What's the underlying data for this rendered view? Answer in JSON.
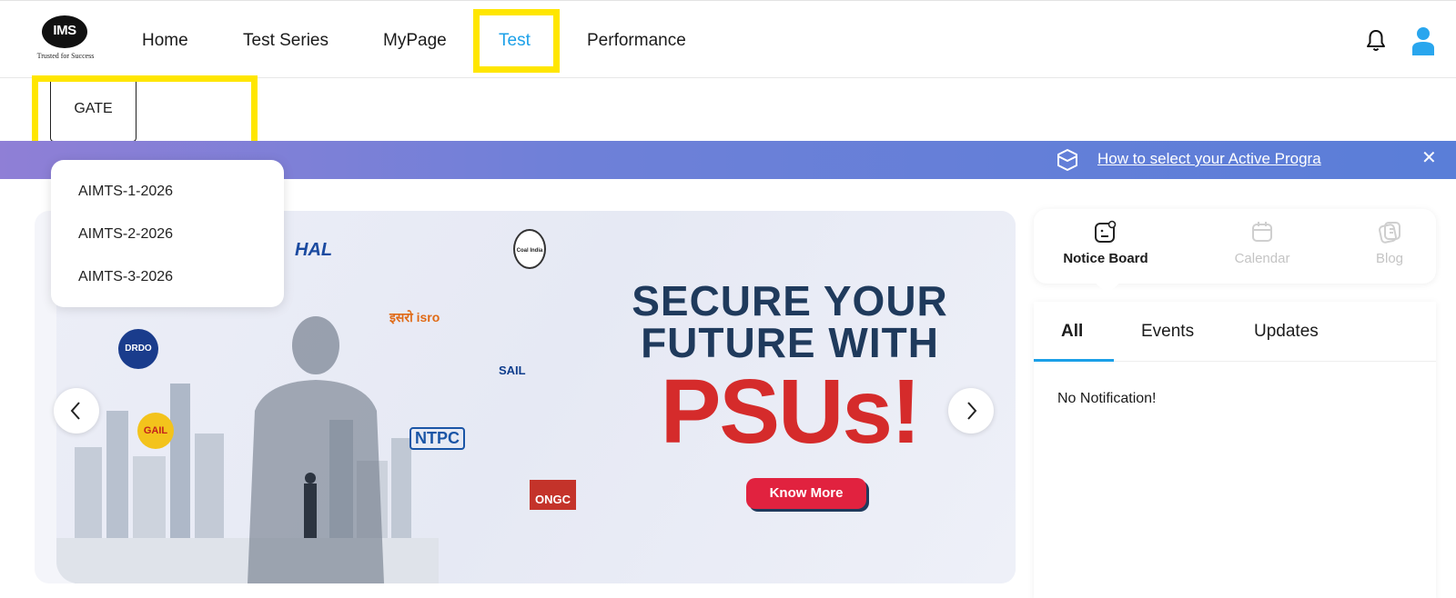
{
  "logo": {
    "text": "IMS",
    "tagline": "Trusted for Success"
  },
  "nav": {
    "items": [
      {
        "label": "Home"
      },
      {
        "label": "Test Series"
      },
      {
        "label": "MyPage"
      },
      {
        "label": "Test"
      },
      {
        "label": "Performance"
      }
    ],
    "active": "Test",
    "active_color": "#1ba0e8",
    "icons": [
      "bell-icon",
      "user-icon"
    ]
  },
  "subnav": {
    "tab_label": "GATE"
  },
  "highlight_color": "#ffe600",
  "announcement": {
    "link": "How to select your Active Progra",
    "close": "✕"
  },
  "dropdown": {
    "options": [
      "AIMTS-1-2026",
      "AIMTS-2-2026",
      "AIMTS-3-2026"
    ]
  },
  "banner": {
    "line1": "SECURE YOUR",
    "line2": "FUTURE WITH",
    "line3": "PSUs!",
    "cta": "Know More",
    "logos": [
      "HAL",
      "इसरो isro",
      "SAIL",
      "NTPC",
      "ONGC",
      "GAIL",
      "DRDO",
      "Coal India"
    ]
  },
  "side_panel": {
    "tabs": [
      {
        "label": "Notice Board",
        "active": true
      },
      {
        "label": "Calendar",
        "active": false
      },
      {
        "label": "Blog",
        "active": false
      }
    ],
    "filters": [
      {
        "label": "All"
      },
      {
        "label": "Events"
      },
      {
        "label": "Updates"
      }
    ],
    "active_filter": "All",
    "empty_message": "No Notification!"
  }
}
